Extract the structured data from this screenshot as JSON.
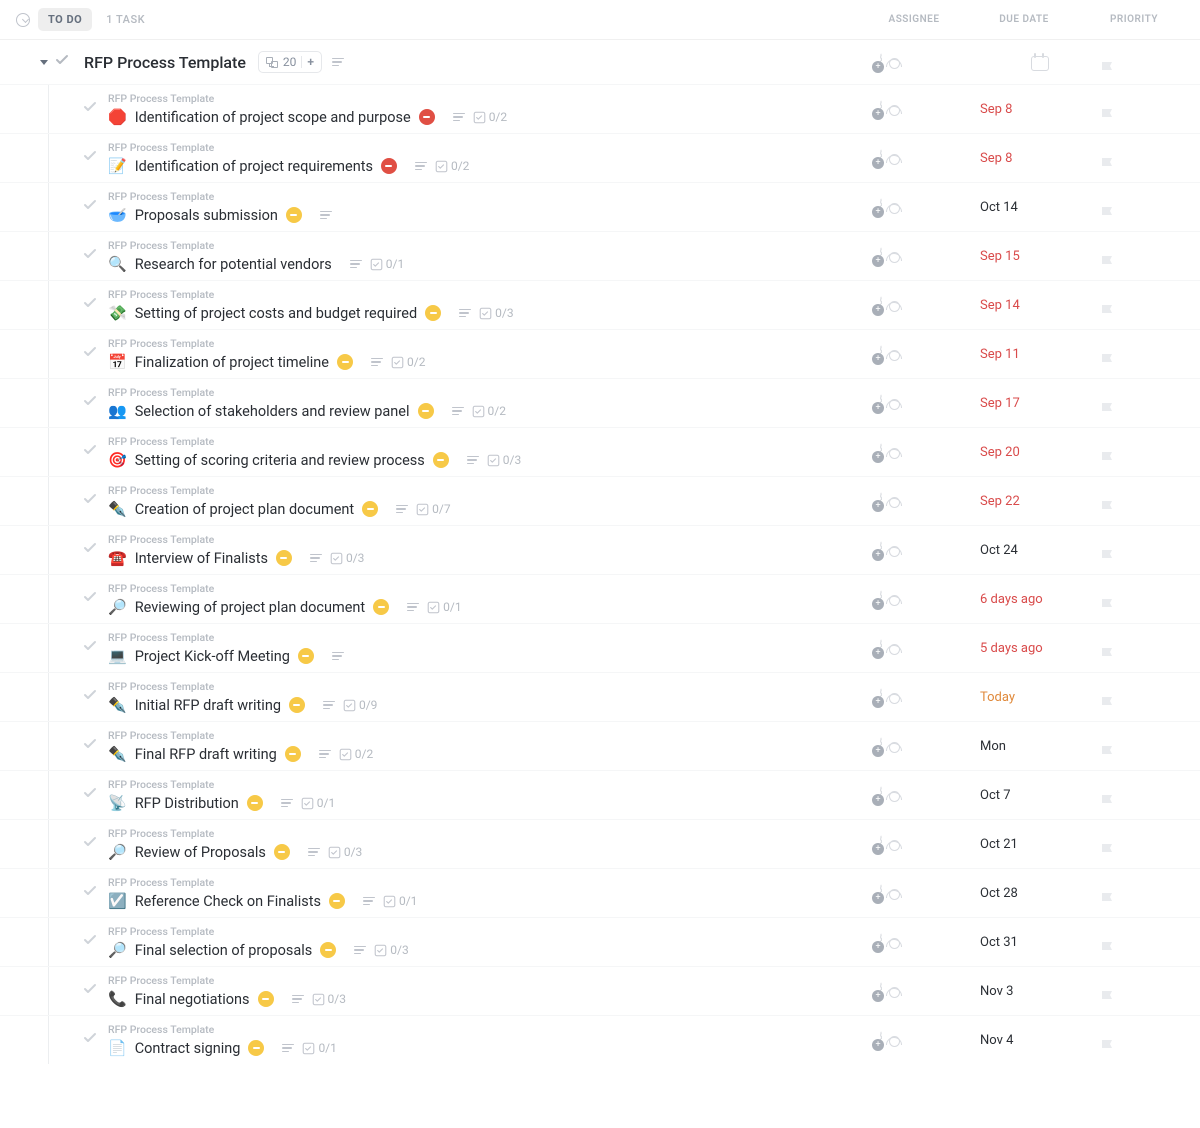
{
  "header": {
    "status_label": "TO DO",
    "task_count_label": "1 TASK",
    "col_assignee": "ASSIGNEE",
    "col_due": "DUE DATE",
    "col_priority": "PRIORITY"
  },
  "group": {
    "title": "RFP Process Template",
    "subtask_count": "20",
    "plus": "+"
  },
  "template_label": "RFP Process Template",
  "tasks": [
    {
      "emoji": "🛑",
      "title": "Identification of project scope and purpose",
      "status": "red",
      "desc": true,
      "checklist": "0/2",
      "due": "Sep 8",
      "due_class": "overdue"
    },
    {
      "emoji": "📝",
      "title": "Identification of project requirements",
      "status": "red",
      "desc": true,
      "checklist": "0/2",
      "due": "Sep 8",
      "due_class": "overdue"
    },
    {
      "emoji": "🥣",
      "title": "Proposals submission",
      "status": "yellow",
      "desc": true,
      "checklist": "",
      "due": "Oct 14",
      "due_class": ""
    },
    {
      "emoji": "🔍",
      "title": "Research for potential vendors",
      "status": "",
      "desc": true,
      "checklist": "0/1",
      "due": "Sep 15",
      "due_class": "overdue"
    },
    {
      "emoji": "💸",
      "title": "Setting of project costs and budget required",
      "status": "yellow",
      "desc": true,
      "checklist": "0/3",
      "due": "Sep 14",
      "due_class": "overdue"
    },
    {
      "emoji": "📅",
      "title": "Finalization of project timeline",
      "status": "yellow",
      "desc": true,
      "checklist": "0/2",
      "due": "Sep 11",
      "due_class": "overdue"
    },
    {
      "emoji": "👥",
      "title": "Selection of stakeholders and review panel",
      "status": "yellow",
      "desc": true,
      "checklist": "0/2",
      "due": "Sep 17",
      "due_class": "overdue"
    },
    {
      "emoji": "🎯",
      "title": "Setting of scoring criteria and review process",
      "status": "yellow",
      "desc": true,
      "checklist": "0/3",
      "due": "Sep 20",
      "due_class": "overdue"
    },
    {
      "emoji": "✒️",
      "title": "Creation of project plan document",
      "status": "yellow",
      "desc": true,
      "checklist": "0/7",
      "due": "Sep 22",
      "due_class": "overdue"
    },
    {
      "emoji": "☎️",
      "title": "Interview of Finalists",
      "status": "yellow",
      "desc": true,
      "checklist": "0/3",
      "due": "Oct 24",
      "due_class": ""
    },
    {
      "emoji": "🔎",
      "title": "Reviewing of project plan document",
      "status": "yellow",
      "desc": true,
      "checklist": "0/1",
      "due": "6 days ago",
      "due_class": "overdue"
    },
    {
      "emoji": "💻",
      "title": "Project Kick-off Meeting",
      "status": "yellow",
      "desc": true,
      "checklist": "",
      "due": "5 days ago",
      "due_class": "overdue"
    },
    {
      "emoji": "✒️",
      "title": "Initial RFP draft writing",
      "status": "yellow",
      "desc": true,
      "checklist": "0/9",
      "due": "Today",
      "due_class": "today"
    },
    {
      "emoji": "✒️",
      "title": "Final RFP draft writing",
      "status": "yellow",
      "desc": true,
      "checklist": "0/2",
      "due": "Mon",
      "due_class": ""
    },
    {
      "emoji": "📡",
      "title": "RFP Distribution",
      "status": "yellow",
      "desc": true,
      "checklist": "0/1",
      "due": "Oct 7",
      "due_class": ""
    },
    {
      "emoji": "🔎",
      "title": "Review of Proposals",
      "status": "yellow",
      "desc": true,
      "checklist": "0/3",
      "due": "Oct 21",
      "due_class": ""
    },
    {
      "emoji": "☑️",
      "title": "Reference Check on Finalists",
      "status": "yellow",
      "desc": true,
      "checklist": "0/1",
      "due": "Oct 28",
      "due_class": ""
    },
    {
      "emoji": "🔎",
      "title": "Final selection of proposals",
      "status": "yellow",
      "desc": true,
      "checklist": "0/3",
      "due": "Oct 31",
      "due_class": ""
    },
    {
      "emoji": "📞",
      "title": "Final negotiations",
      "status": "yellow",
      "desc": true,
      "checklist": "0/3",
      "due": "Nov 3",
      "due_class": ""
    },
    {
      "emoji": "📄",
      "title": "Contract signing",
      "status": "yellow",
      "desc": true,
      "checklist": "0/1",
      "due": "Nov 4",
      "due_class": ""
    }
  ]
}
